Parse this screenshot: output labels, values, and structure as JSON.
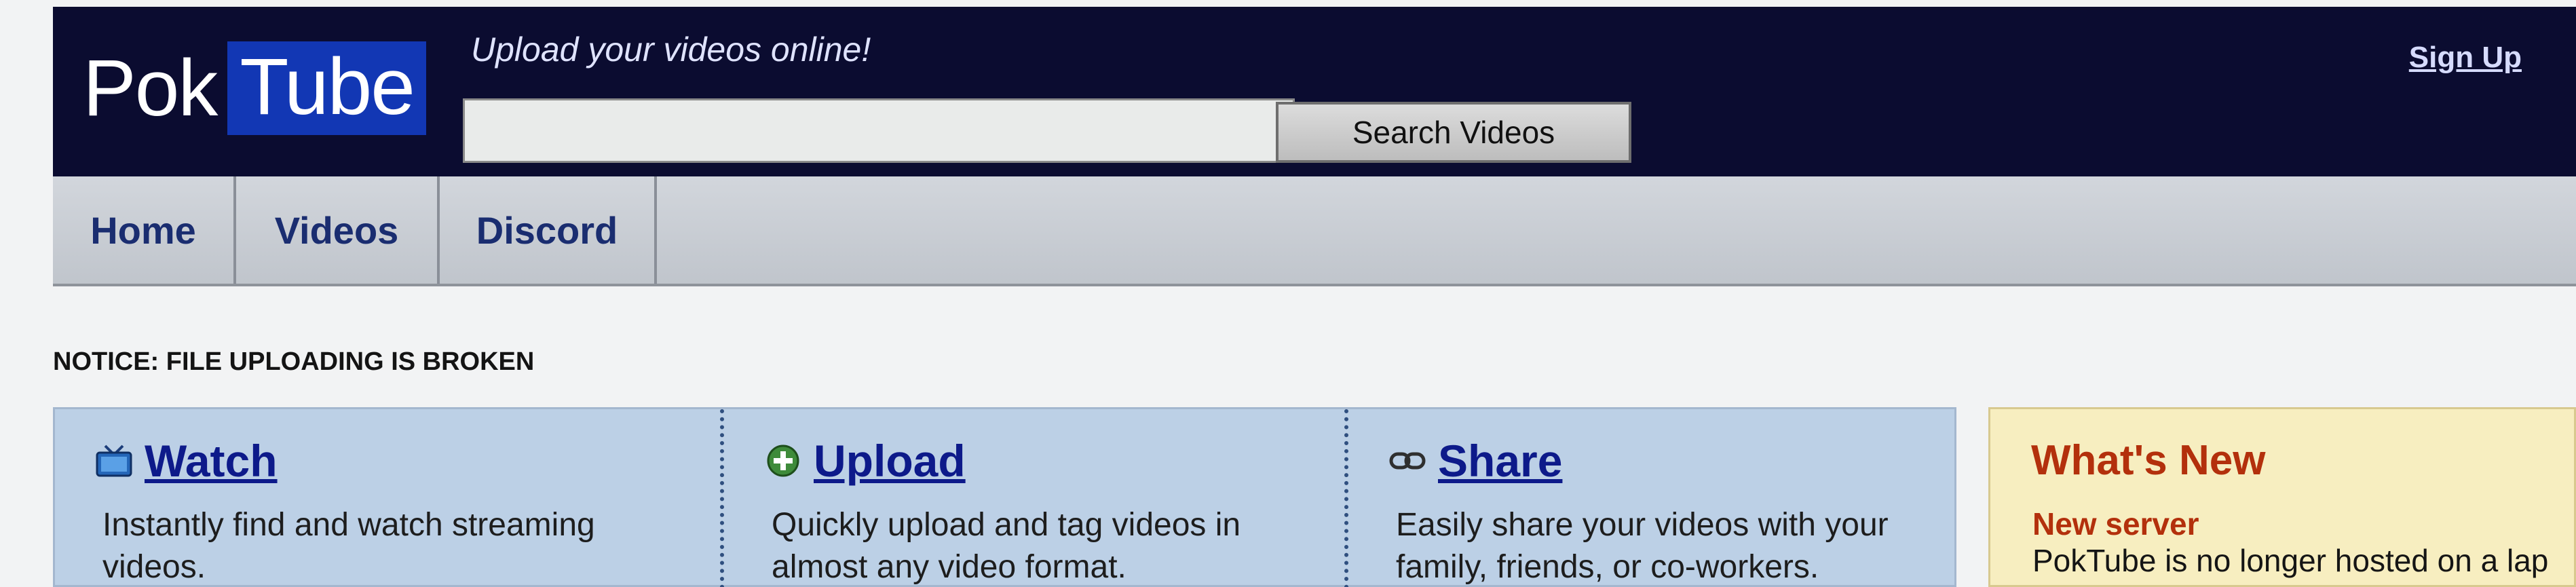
{
  "header": {
    "logo_word1": "Pok",
    "logo_word2": "Tube",
    "tagline": "Upload your videos online!",
    "search_value": "",
    "search_button": "Search Videos",
    "signup_label": "Sign Up"
  },
  "nav": {
    "tabs": [
      {
        "label": "Home"
      },
      {
        "label": "Videos"
      },
      {
        "label": "Discord"
      }
    ]
  },
  "notice": "NOTICE: FILE UPLOADING IS BROKEN",
  "features": [
    {
      "icon": "tv-icon",
      "title": "Watch",
      "desc": "Instantly find and watch streaming videos."
    },
    {
      "icon": "plus-circle-icon",
      "title": "Upload",
      "desc": "Quickly upload and tag videos in almost any video format."
    },
    {
      "icon": "share-icon",
      "title": "Share",
      "desc": "Easily share your videos with your family, friends, or co-workers."
    }
  ],
  "whats_new": {
    "title": "What's New",
    "items": [
      {
        "title": "New server",
        "body": "PokTube is no longer hosted on a lap"
      }
    ]
  },
  "colors": {
    "header_bg": "#0b0c30",
    "logo_accent": "#1237b4",
    "nav_text": "#1a2d70",
    "feature_bg": "#bcd0e6",
    "link": "#0d1a8a",
    "whats_new_bg": "#f7eec0",
    "whats_new_accent": "#b3300c"
  }
}
